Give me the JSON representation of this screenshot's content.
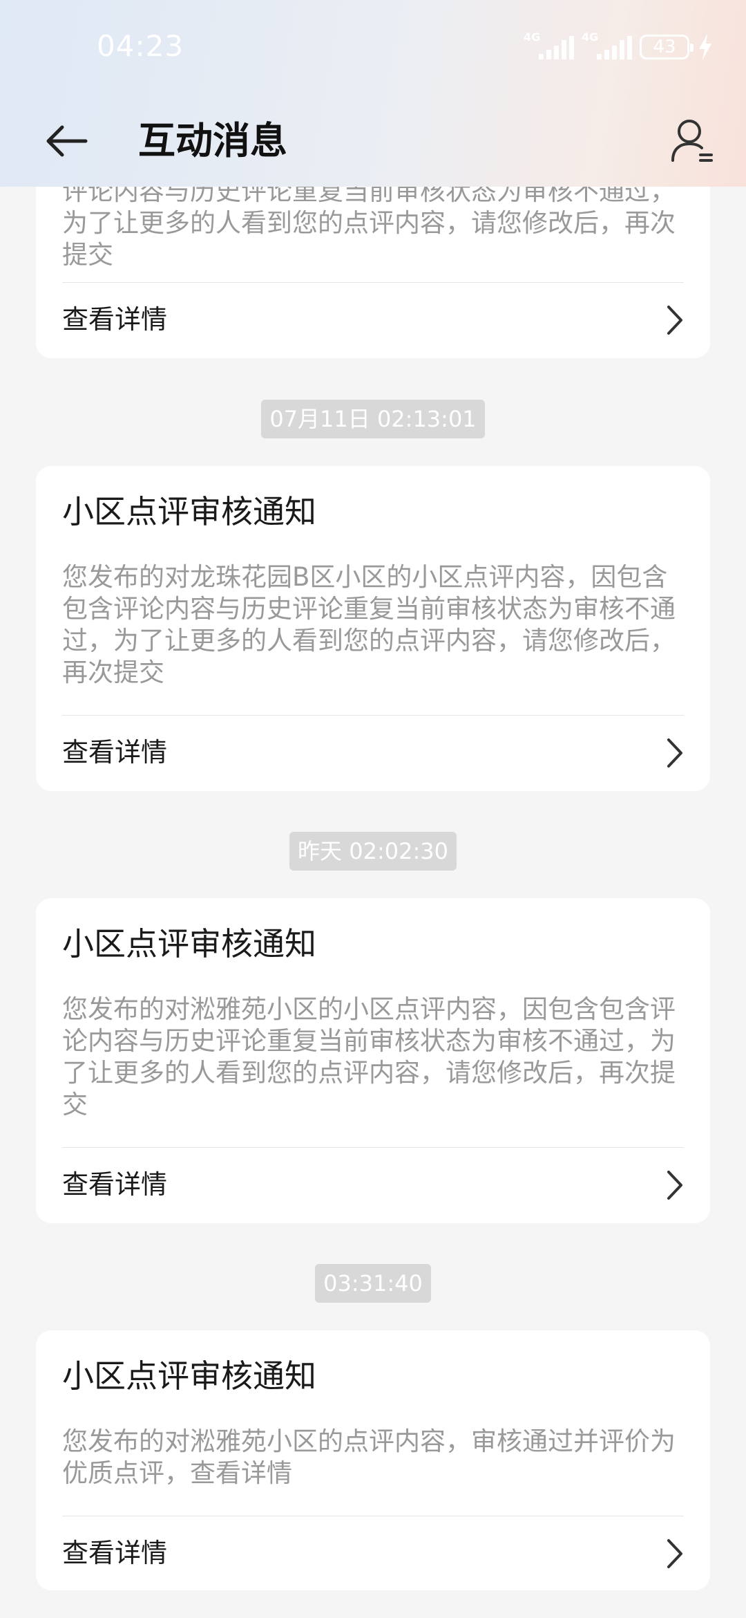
{
  "status_bar": {
    "time": "04:23",
    "network_1": "4G",
    "network_2": "4G",
    "battery": "43"
  },
  "header": {
    "title": "互动消息"
  },
  "messages": [
    {
      "body": "评论内容与历史评论重复当前审核状态为审核不通过，为了让更多的人看到您的点评内容，请您修改后，再次提交",
      "link": "查看详情"
    },
    {
      "timestamp": "07月11日 02:13:01",
      "title": "小区点评审核通知",
      "body": "您发布的对龙珠花园B区小区的小区点评内容，因包含包含评论内容与历史评论重复当前审核状态为审核不通过，为了让更多的人看到您的点评内容，请您修改后，再次提交",
      "link": "查看详情"
    },
    {
      "timestamp": "昨天 02:02:30",
      "title": "小区点评审核通知",
      "body": "您发布的对淞雅苑小区的小区点评内容，因包含包含评论内容与历史评论重复当前审核状态为审核不通过，为了让更多的人看到您的点评内容，请您修改后，再次提交",
      "link": "查看详情"
    },
    {
      "timestamp": "03:31:40",
      "title": "小区点评审核通知",
      "body": "您发布的对淞雅苑小区的点评内容，审核通过并评价为优质点评，查看详情",
      "link": "查看详情"
    }
  ],
  "icons": {
    "back": "arrow-left-icon",
    "profile": "user-profile-icon",
    "chevron": "chevron-right-icon"
  }
}
